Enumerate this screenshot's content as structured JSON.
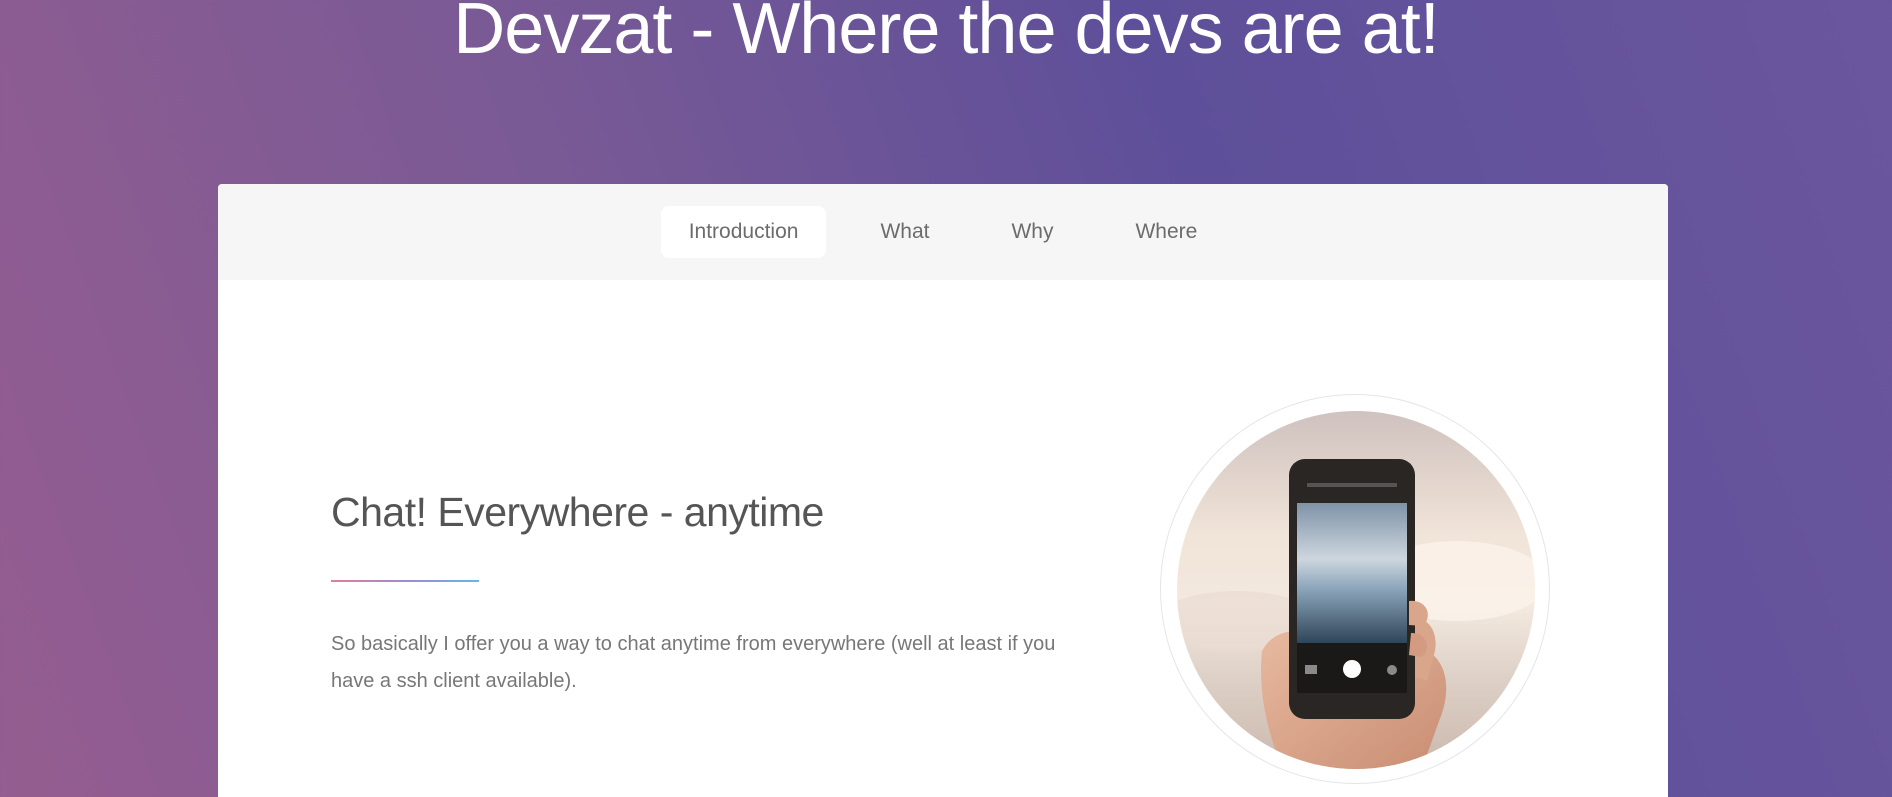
{
  "header": {
    "title": "Devzat - Where the devs are at!"
  },
  "nav": {
    "tabs": [
      {
        "label": "Introduction",
        "active": true
      },
      {
        "label": "What",
        "active": false
      },
      {
        "label": "Why",
        "active": false
      },
      {
        "label": "Where",
        "active": false
      }
    ]
  },
  "intro": {
    "heading": "Chat! Everywhere - anytime",
    "text": "So basically I offer you a way to chat anytime from everywhere (well at least if you have a ssh client available).",
    "image": "hand-holding-phone-photographing-sunset-sea"
  },
  "colors": {
    "gradient_left": "#955d90",
    "gradient_right": "#5e4f9a",
    "divider_start": "#e47d9d",
    "divider_end": "#64b7e8"
  }
}
